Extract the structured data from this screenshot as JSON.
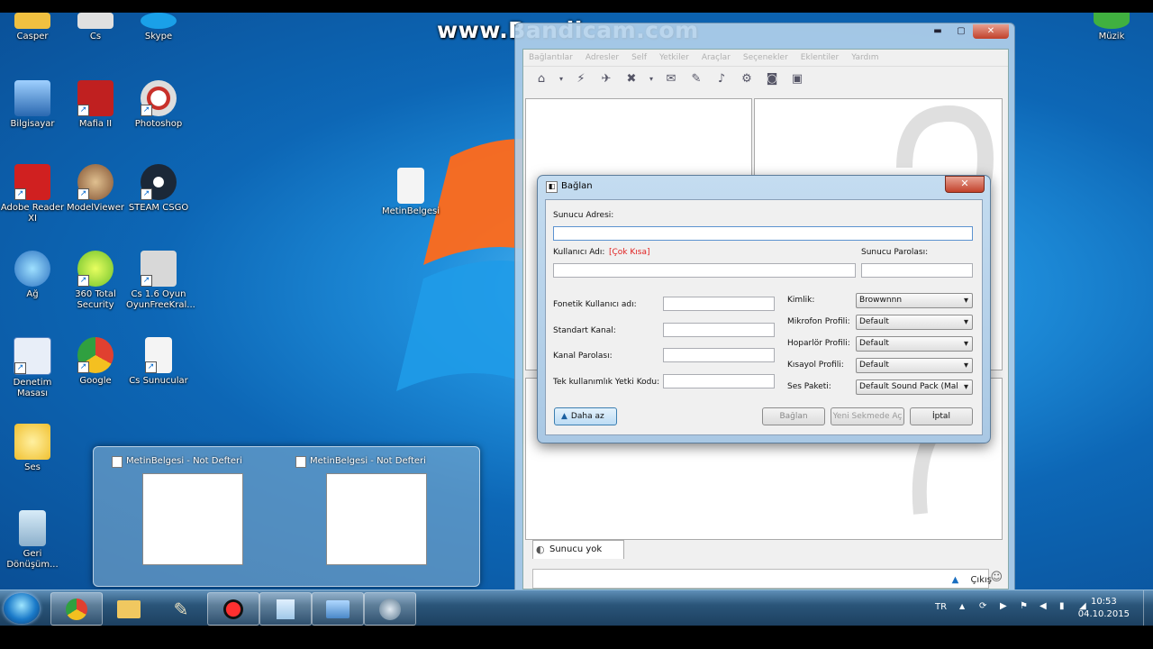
{
  "watermark": "www.Bandicam.com",
  "desktop_icons": [
    {
      "label": "Casper",
      "color": "#f0c040"
    },
    {
      "label": "Cs",
      "color": "#e0e0e0"
    },
    {
      "label": "Skype",
      "color": "#1aa0e8"
    },
    {
      "label": "Bilgisayar",
      "color": "#3a78c0"
    },
    {
      "label": "Mafia II",
      "color": "#c02020"
    },
    {
      "label": "Photoshop",
      "color": "#c0c0c0"
    },
    {
      "label": "Adobe Reader XI",
      "color": "#d02020"
    },
    {
      "label": "ModelViewer",
      "color": "#a08060"
    },
    {
      "label": "STEAM CSGO",
      "color": "#1b2838"
    },
    {
      "label": "Ağ",
      "color": "#3a90d0"
    },
    {
      "label": "360 Total Security",
      "color": "#6cc02a"
    },
    {
      "label": "Cs 1.6 Oyun OyunFreeKral...",
      "color": "#d0d0d0"
    },
    {
      "label": "Denetim Masası",
      "color": "#5080c0"
    },
    {
      "label": "Google",
      "color": "#e04030"
    },
    {
      "label": "Cs Sunucular",
      "color": "#f4f4f4"
    },
    {
      "label": "Ses",
      "color": "#f0d040"
    },
    {
      "label": "Geri Dönüşüm...",
      "color": "#a0c0d8"
    },
    {
      "label": "MetinBelgesi",
      "color": "#f0f0f0"
    },
    {
      "label": "Müzik",
      "color": "#40b040"
    }
  ],
  "preview": {
    "items": [
      {
        "title": "MetinBelgesi - Not Defteri"
      },
      {
        "title": "MetinBelgesi - Not Defteri"
      }
    ]
  },
  "teamspeak": {
    "menu": [
      "Bağlantılar",
      "Adresler",
      "Self",
      "Yetkiler",
      "Araçlar",
      "Seçenekler",
      "Eklentiler",
      "Yardım"
    ],
    "tab_label": "Sunucu yok",
    "status_label": "Çıkış"
  },
  "dialog": {
    "title": "Bağlan",
    "server_address_label": "Sunucu Adresi:",
    "server_address_value": "",
    "username_label": "Kullanıcı Adı:",
    "username_warning": "[Çok Kısa]",
    "server_password_label": "Sunucu Parolası:",
    "phonetic_label": "Fonetik Kullanıcı adı:",
    "default_channel_label": "Standart Kanal:",
    "channel_password_label": "Kanal Parolası:",
    "privilege_key_label": "Tek kullanımlık Yetki Kodu:",
    "identity_label": "Kimlik:",
    "identity_value": "Browwnnn",
    "mic_profile_label": "Mikrofon Profili:",
    "mic_profile_value": "Default",
    "speaker_profile_label": "Hoparlör Profili:",
    "speaker_profile_value": "Default",
    "hotkey_profile_label": "Kısayol Profili:",
    "hotkey_profile_value": "Default",
    "sound_pack_label": "Ses Paketi:",
    "sound_pack_value": "Default Sound Pack (Mal",
    "less_button": "Daha az",
    "connect_button": "Bağlan",
    "new_tab_button": "Yeni Sekmede Aç",
    "cancel_button": "İptal"
  },
  "tray": {
    "language": "TR",
    "time": "10:53",
    "date": "04.10.2015"
  }
}
